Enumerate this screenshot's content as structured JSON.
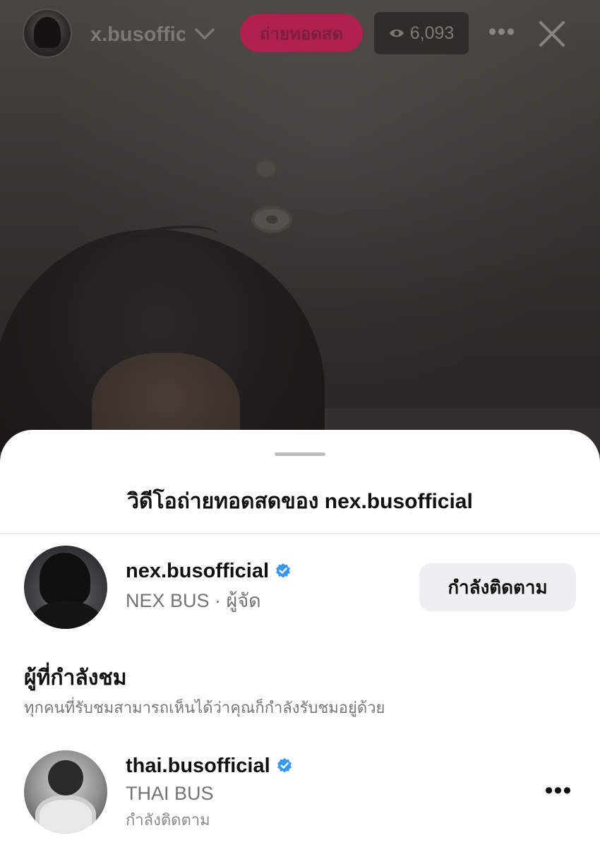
{
  "header": {
    "host_username": "x.busoffic",
    "live_label": "ถ่ายทอดสด",
    "viewer_count": "6,093"
  },
  "sheet": {
    "title": "วิดีโอถ่ายทอดสดของ nex.busofficial",
    "host": {
      "username": "nex.busofficial",
      "subtitle": "NEX BUS · ผู้จัด",
      "verified": true,
      "follow_label": "กำลังติดตาม"
    },
    "viewers_section": {
      "heading": "ผู้ที่กำลังชม",
      "description": "ทุกคนที่รับชมสามารถเห็นได้ว่าคุณก็กำลังรับชมอยู่ด้วย",
      "items": [
        {
          "username": "thai.busofficial",
          "full_name": "THAI BUS",
          "status": "กำลังติดตาม",
          "verified": true
        }
      ]
    }
  },
  "colors": {
    "live_badge": "#b0204f",
    "verified": "#3897f0",
    "follow_button_bg": "#efeff2"
  },
  "icons": [
    "chevron-down-icon",
    "eye-icon",
    "more-icon",
    "close-icon",
    "verified-icon"
  ]
}
